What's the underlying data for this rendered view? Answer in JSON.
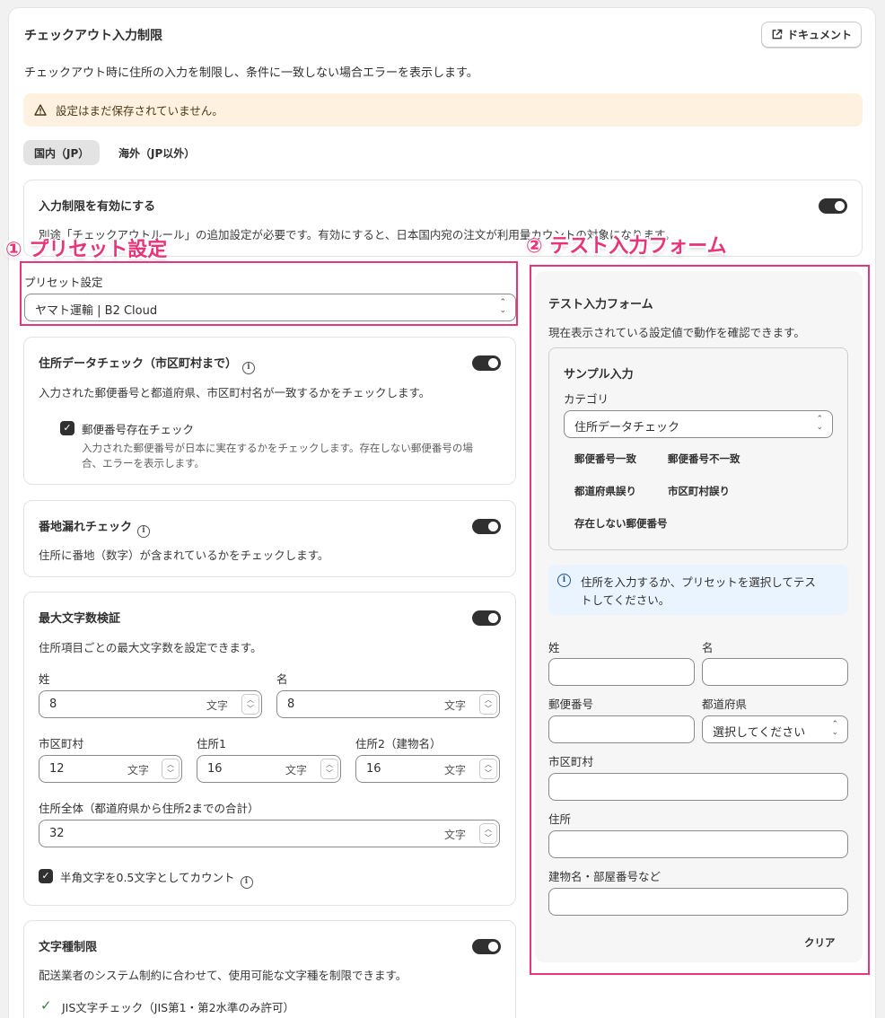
{
  "header": {
    "title": "チェックアウト入力制限",
    "doc_button": "ドキュメント",
    "description": "チェックアウト時に住所の入力を制限し、条件に一致しない場合エラーを表示します。"
  },
  "warning": {
    "text": "設定はまだ保存されていません。"
  },
  "tabs": [
    {
      "label": "国内（JP）"
    },
    {
      "label": "海外（JP以外）"
    }
  ],
  "enable": {
    "title": "入力制限を有効にする",
    "description": "別途「チェックアウトルール」の追加設定が必要です。有効にすると、日本国内宛の注文が利用量カウントの対象になります。"
  },
  "annotations": {
    "left": "① プリセット設定",
    "right": "② テスト入力フォーム"
  },
  "preset": {
    "label": "プリセット設定",
    "value": "ヤマト運輸 | B2 Cloud"
  },
  "address_check": {
    "title": "住所データチェック（市区町村まで）",
    "description": "入力された郵便番号と都道府県、市区町村名が一致するかをチェックします。",
    "postal_check_label": "郵便番号存在チェック",
    "postal_check_desc_1": "入力された郵便番号が日本に実在するかをチェックします。存在しない郵便番号の場",
    "postal_check_desc_2": "合、エラーを表示します。"
  },
  "banchi": {
    "title": "番地漏れチェック",
    "description": "住所に番地（数字）が含まれているかをチェックします。"
  },
  "maxlen": {
    "title": "最大文字数検証",
    "description": "住所項目ごとの最大文字数を設定できます。",
    "unit": "文字",
    "fields": {
      "sei": {
        "label": "姓",
        "value": "8"
      },
      "mei": {
        "label": "名",
        "value": "8"
      },
      "city": {
        "label": "市区町村",
        "value": "12"
      },
      "addr1": {
        "label": "住所1",
        "value": "16"
      },
      "addr2": {
        "label": "住所2（建物名）",
        "value": "16"
      },
      "total": {
        "label": "住所全体（都道府県から住所2までの合計）",
        "value": "32"
      }
    },
    "halfwidth_label": "半角文字を0.5文字としてカウント"
  },
  "chartype": {
    "title": "文字種制限",
    "description": "配送業者のシステム制約に合わせて、使用可能な文字種を制限できます。",
    "jis_label": "JIS文字チェック（JIS第1・第2水準のみ許可）"
  },
  "test_form": {
    "title": "テスト入力フォーム",
    "description": "現在表示されている設定値で動作を確認できます。",
    "sample": {
      "title": "サンプル入力",
      "category_label": "カテゴリ",
      "category_value": "住所データチェック",
      "buttons": [
        "郵便番号一致",
        "郵便番号不一致",
        "都道府県誤り",
        "市区町村誤り",
        "存在しない郵便番号"
      ]
    },
    "info_line1": "住所を入力するか、プリセットを選択してテス",
    "info_line2": "トしてください。",
    "labels": {
      "sei": "姓",
      "mei": "名",
      "postal": "郵便番号",
      "pref": "都道府県",
      "city": "市区町村",
      "address": "住所",
      "building": "建物名・部屋番号など"
    },
    "pref_placeholder": "選択してください",
    "clear_button": "クリア"
  }
}
